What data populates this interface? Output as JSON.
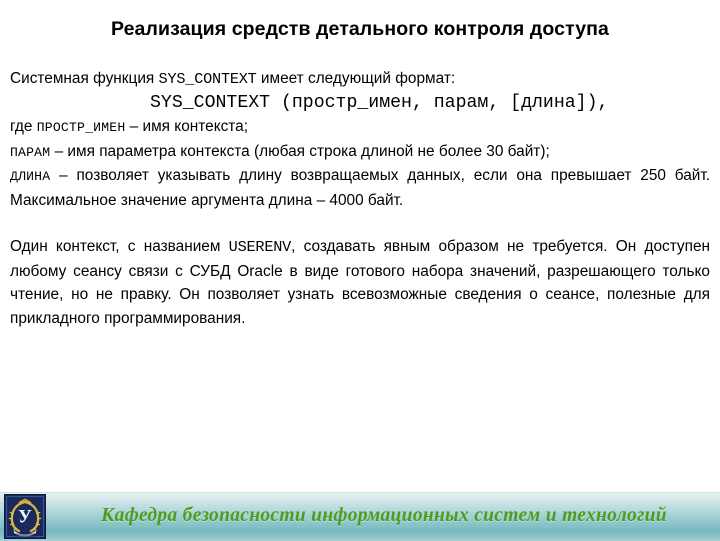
{
  "slide": {
    "title": "Реализация средств детального контроля доступа",
    "background_color": "#ffffff",
    "text_color": "#000000"
  },
  "content": {
    "intro": {
      "prefix": "Системная функция ",
      "code": "SYS_CONTEXT",
      "suffix": " имеет следующий формат:"
    },
    "signature": "SYS_CONTEXT (простр_имен, парам, [длина]),",
    "definitions": [
      {
        "prefix": "где ",
        "term": "ПРОСТР_ИМЕН",
        "text": " – имя контекста;"
      },
      {
        "prefix": "",
        "term": "ПАРАМ",
        "text": " – имя параметра контекста (любая строка длиной не более 30 байт);"
      },
      {
        "prefix": "",
        "term": "ДЛИНА",
        "text": " – позволяет указывать длину возвращаемых данных, если она превышает 250 байт. Максимальное значение аргумента длина – 4000 байт."
      }
    ],
    "paragraph": {
      "part1": "Один контекст, с названием ",
      "code": "USERENV",
      "part2": ", создавать явным образом не требуется. Он доступен любому сеансу связи с СУБД Oracle в виде готового набора значений, разрешающего только чтение, но не правку. Он позволяет узнать всевозможные сведения о сеансе, полезные для прикладного программирования."
    }
  },
  "footer": {
    "text": "Кафедра безопасности информационных систем и технологий",
    "text_color": "#4e9c1e",
    "bar_color_top": "#e8f2f2",
    "bar_color_bottom": "#79b9c0",
    "emblem": {
      "letter": "У",
      "background_color": "#1c2c5e",
      "wreath_color": "#d8b43c"
    }
  }
}
